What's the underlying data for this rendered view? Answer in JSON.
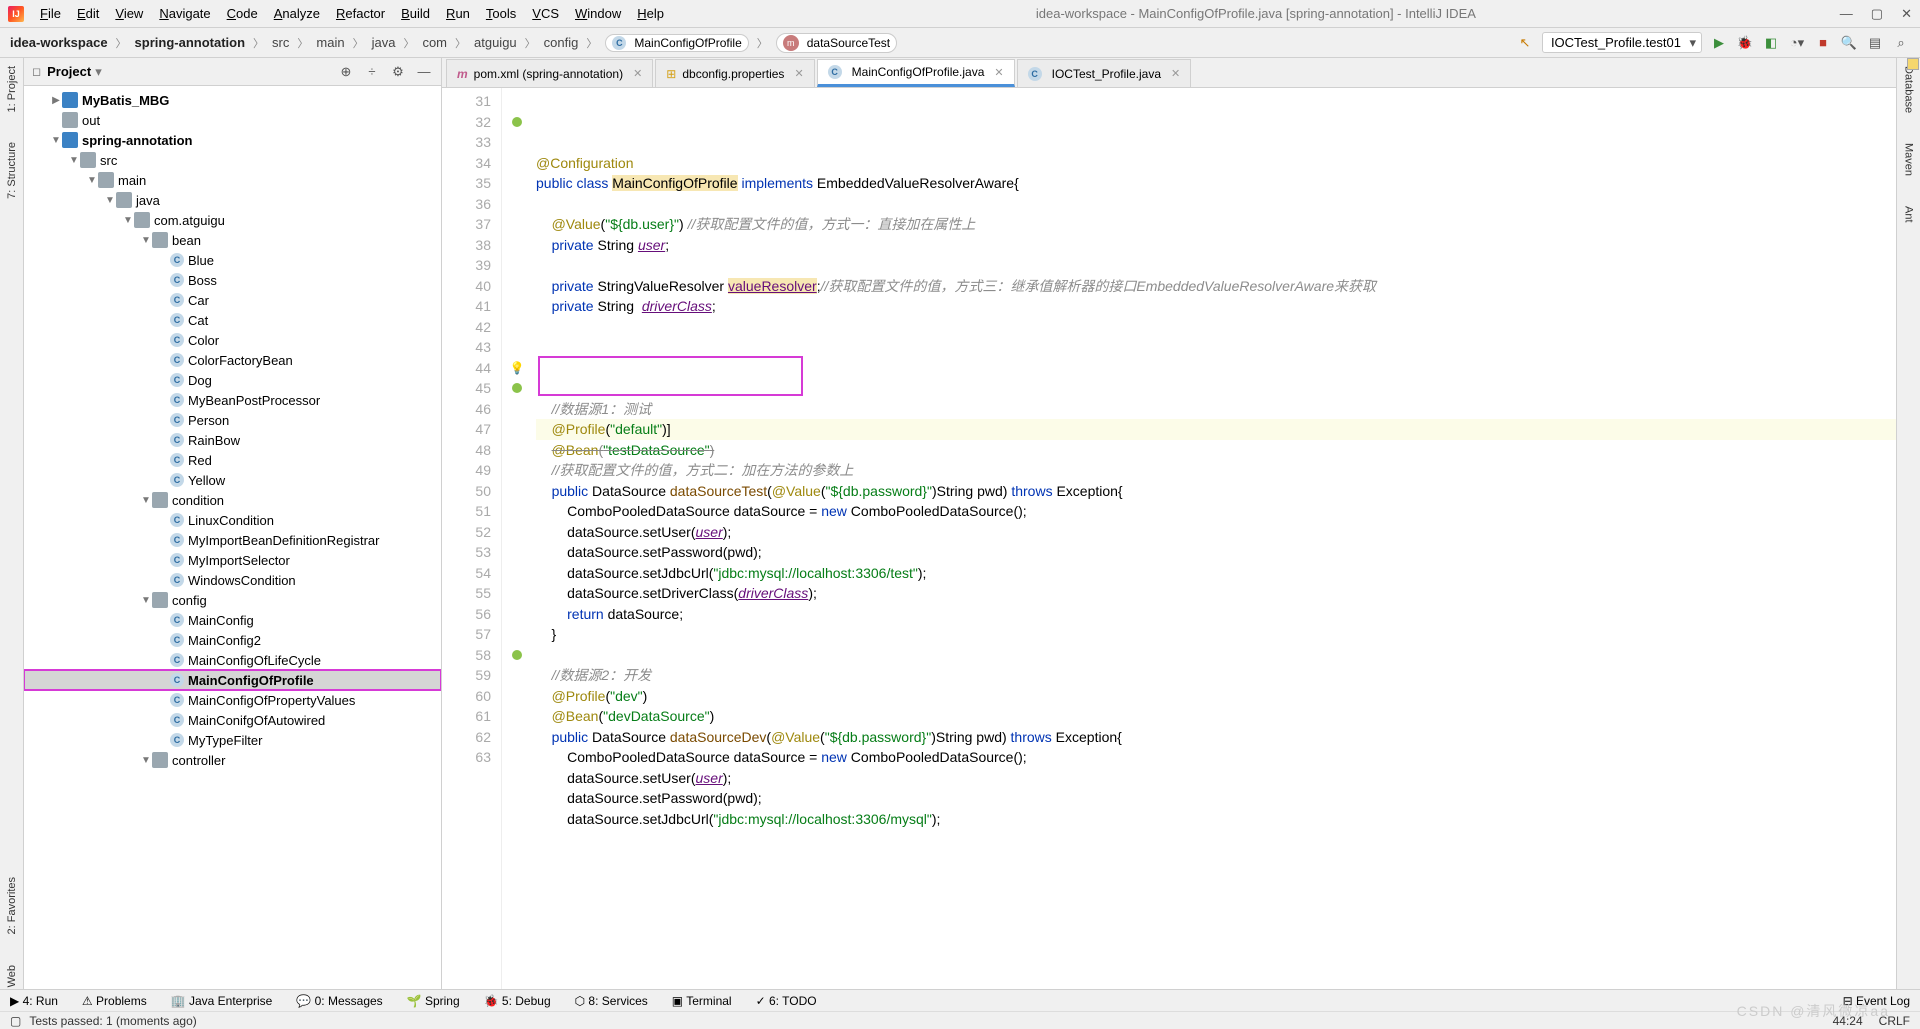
{
  "menu": [
    "File",
    "Edit",
    "View",
    "Navigate",
    "Code",
    "Analyze",
    "Refactor",
    "Build",
    "Run",
    "Tools",
    "VCS",
    "Window",
    "Help"
  ],
  "window_title": "idea-workspace - MainConfigOfProfile.java [spring-annotation] - IntelliJ IDEA",
  "breadcrumb": {
    "parts": [
      "idea-workspace",
      "spring-annotation",
      "src",
      "main",
      "java",
      "com",
      "atguigu",
      "config"
    ],
    "class_pill": "MainConfigOfProfile",
    "method_pill": "dataSourceTest"
  },
  "run_config": "IOCTest_Profile.test01",
  "left_rail": [
    "1: Project",
    "7: Structure",
    "2: Favorites",
    "Web"
  ],
  "right_rail": [
    "Database",
    "Maven",
    "Ant"
  ],
  "project_header": "Project",
  "tree": [
    {
      "d": 1,
      "ch": "▶",
      "ic": "mod",
      "t": "MyBatis_MBG",
      "bold": true
    },
    {
      "d": 1,
      "ch": "",
      "ic": "dir",
      "t": "out"
    },
    {
      "d": 1,
      "ch": "▼",
      "ic": "mod",
      "t": "spring-annotation",
      "bold": true
    },
    {
      "d": 2,
      "ch": "▼",
      "ic": "dir",
      "t": "src"
    },
    {
      "d": 3,
      "ch": "▼",
      "ic": "dir",
      "t": "main"
    },
    {
      "d": 4,
      "ch": "▼",
      "ic": "dir",
      "t": "java"
    },
    {
      "d": 5,
      "ch": "▼",
      "ic": "dir",
      "t": "com.atguigu"
    },
    {
      "d": 6,
      "ch": "▼",
      "ic": "dir",
      "t": "bean"
    },
    {
      "d": 7,
      "ch": "",
      "ic": "cls",
      "t": "Blue"
    },
    {
      "d": 7,
      "ch": "",
      "ic": "cls",
      "t": "Boss"
    },
    {
      "d": 7,
      "ch": "",
      "ic": "cls",
      "t": "Car"
    },
    {
      "d": 7,
      "ch": "",
      "ic": "cls",
      "t": "Cat"
    },
    {
      "d": 7,
      "ch": "",
      "ic": "cls",
      "t": "Color"
    },
    {
      "d": 7,
      "ch": "",
      "ic": "cls",
      "t": "ColorFactoryBean"
    },
    {
      "d": 7,
      "ch": "",
      "ic": "cls",
      "t": "Dog"
    },
    {
      "d": 7,
      "ch": "",
      "ic": "cls",
      "t": "MyBeanPostProcessor"
    },
    {
      "d": 7,
      "ch": "",
      "ic": "cls",
      "t": "Person"
    },
    {
      "d": 7,
      "ch": "",
      "ic": "cls",
      "t": "RainBow"
    },
    {
      "d": 7,
      "ch": "",
      "ic": "cls",
      "t": "Red"
    },
    {
      "d": 7,
      "ch": "",
      "ic": "cls",
      "t": "Yellow"
    },
    {
      "d": 6,
      "ch": "▼",
      "ic": "dir",
      "t": "condition"
    },
    {
      "d": 7,
      "ch": "",
      "ic": "cls",
      "t": "LinuxCondition"
    },
    {
      "d": 7,
      "ch": "",
      "ic": "cls",
      "t": "MyImportBeanDefinitionRegistrar"
    },
    {
      "d": 7,
      "ch": "",
      "ic": "cls",
      "t": "MyImportSelector"
    },
    {
      "d": 7,
      "ch": "",
      "ic": "cls",
      "t": "WindowsCondition"
    },
    {
      "d": 6,
      "ch": "▼",
      "ic": "dir",
      "t": "config"
    },
    {
      "d": 7,
      "ch": "",
      "ic": "cls",
      "t": "MainConfig"
    },
    {
      "d": 7,
      "ch": "",
      "ic": "cls",
      "t": "MainConfig2"
    },
    {
      "d": 7,
      "ch": "",
      "ic": "cls",
      "t": "MainConfigOfLifeCycle"
    },
    {
      "d": 7,
      "ch": "",
      "ic": "cls",
      "t": "MainConfigOfProfile",
      "sel": true,
      "hl": true,
      "bold": true
    },
    {
      "d": 7,
      "ch": "",
      "ic": "cls",
      "t": "MainConfigOfPropertyValues"
    },
    {
      "d": 7,
      "ch": "",
      "ic": "cls",
      "t": "MainConifgOfAutowired"
    },
    {
      "d": 7,
      "ch": "",
      "ic": "cls",
      "t": "MyTypeFilter"
    },
    {
      "d": 6,
      "ch": "▼",
      "ic": "dir",
      "t": "controller"
    }
  ],
  "tabs": [
    {
      "icon": "m",
      "label": "pom.xml (spring-annotation)",
      "active": false
    },
    {
      "icon": "p",
      "label": "dbconfig.properties",
      "active": false
    },
    {
      "icon": "c",
      "label": "MainConfigOfProfile.java",
      "active": true
    },
    {
      "icon": "c",
      "label": "IOCTest_Profile.java",
      "active": false
    }
  ],
  "code_lines": [
    31,
    32,
    33,
    34,
    35,
    36,
    37,
    38,
    39,
    40,
    41,
    42,
    43,
    44,
    45,
    46,
    47,
    48,
    49,
    50,
    51,
    52,
    53,
    54,
    55,
    56,
    57,
    58,
    59,
    60,
    61,
    62,
    63
  ],
  "code": {
    "l31": {
      "ann": "@Configuration"
    },
    "l32": {
      "a": "public",
      "b": "class",
      "c": "MainConfigOfProfile",
      "d": "implements",
      "e": "EmbeddedValueResolverAware{"
    },
    "l34": {
      "ann": "@Value",
      "s": "\"${db.user}\"",
      "c": "//获取配置文件的值，方式一：直接加在属性上"
    },
    "l35": {
      "a": "private",
      "b": "String",
      "c": "user",
      ";": ";"
    },
    "l37": {
      "a": "private",
      "b": "StringValueResolver",
      "c": "valueResolver",
      "d": ";",
      "e": "//获取配置文件的值，方式三：继承值解析器的接口EmbeddedValueResolverAware来获取"
    },
    "l38": {
      "a": "private",
      "b": "String",
      "c": "driverClass",
      ";": ";"
    },
    "l43": {
      "c": "//数据源1：测试"
    },
    "l44": {
      "ann": "@Profile",
      "s": "\"default\""
    },
    "l45": {
      "ann": "@Bean",
      "s": "\"testDataSource\""
    },
    "l46": {
      "c": "//获取配置文件的值，方式二：加在方法的参数上"
    },
    "l47": {
      "a": "public",
      "b": "DataSource",
      "m": "dataSourceTest",
      "ann": "@Value",
      "s": "\"${db.password}\"",
      "p": ")String pwd)",
      "t": "throws",
      "e": "Exception{"
    },
    "l48": {
      "a": "ComboPooledDataSource dataSource = ",
      "k": "new",
      "b": " ComboPooledDataSource();"
    },
    "l49": {
      "a": "dataSource.setUser(",
      "v": "user",
      "b": ");"
    },
    "l50": {
      "a": "dataSource.setPassword(pwd);"
    },
    "l51": {
      "a": "dataSource.setJdbcUrl(",
      "s": "\"jdbc:mysql://localhost:3306/test\"",
      "b": ");"
    },
    "l52": {
      "a": "dataSource.setDriverClass(",
      "v": "driverClass",
      "b": ");"
    },
    "l53": {
      "k": "return",
      "a": " dataSource;"
    },
    "l54": {
      "a": "}"
    },
    "l56": {
      "c": "//数据源2：开发"
    },
    "l57": {
      "ann": "@Profile",
      "s": "\"dev\""
    },
    "l58": {
      "ann": "@Bean",
      "s": "\"devDataSource\""
    },
    "l59": {
      "a": "public",
      "b": "DataSource",
      "m": "dataSourceDev",
      "ann": "@Value",
      "s": "\"${db.password}\"",
      "p": ")String pwd)",
      "t": "throws",
      "e": "Exception{"
    },
    "l60": {
      "a": "ComboPooledDataSource dataSource = ",
      "k": "new",
      "b": " ComboPooledDataSource();"
    },
    "l61": {
      "a": "dataSource.setUser(",
      "v": "user",
      "b": ");"
    },
    "l62": {
      "a": "dataSource.setPassword(pwd);"
    },
    "l63": {
      "a": "dataSource.setJdbcUrl(",
      "s": "\"jdbc:mysql://localhost:3306/mysql\"",
      "b": ");"
    }
  },
  "bottom_tools": [
    "▶ 4: Run",
    "⚠ Problems",
    "🏢 Java Enterprise",
    "💬 0: Messages",
    "🌱 Spring",
    "🐞 5: Debug",
    "⬡ 8: Services",
    "▣ Terminal",
    "✓ 6: TODO"
  ],
  "event_log": "Event Log",
  "status_msg": "Tests passed: 1 (moments ago)",
  "cursor_pos": "44:24",
  "line_ending": "CRLF",
  "watermark": "CSDN @清风微凉aa"
}
